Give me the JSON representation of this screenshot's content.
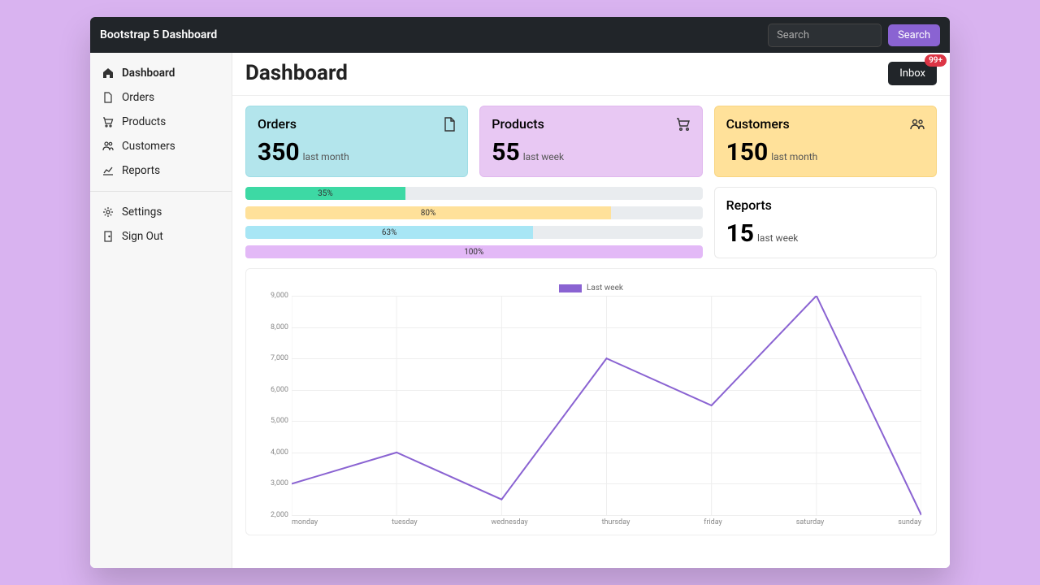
{
  "brand": "Bootstrap 5 Dashboard",
  "search": {
    "placeholder": "Search",
    "button": "Search"
  },
  "sidebar": {
    "items": [
      {
        "label": "Dashboard",
        "icon": "home"
      },
      {
        "label": "Orders",
        "icon": "file"
      },
      {
        "label": "Products",
        "icon": "cart"
      },
      {
        "label": "Customers",
        "icon": "users"
      },
      {
        "label": "Reports",
        "icon": "chart"
      }
    ],
    "items2": [
      {
        "label": "Settings",
        "icon": "gear"
      },
      {
        "label": "Sign Out",
        "icon": "door"
      }
    ]
  },
  "page": {
    "title": "Dashboard",
    "inbox_label": "Inbox",
    "inbox_badge": "99+"
  },
  "cards": {
    "orders": {
      "title": "Orders",
      "value": "350",
      "period": "last month"
    },
    "products": {
      "title": "Products",
      "value": "55",
      "period": "last week"
    },
    "customers": {
      "title": "Customers",
      "value": "150",
      "period": "last month"
    },
    "reports": {
      "title": "Reports",
      "value": "15",
      "period": "last week"
    }
  },
  "progress": [
    {
      "pct": 35,
      "label": "35%",
      "color": "#3dd9a4"
    },
    {
      "pct": 80,
      "label": "80%",
      "color": "#ffe19a"
    },
    {
      "pct": 63,
      "label": "63%",
      "color": "#a8e6f5"
    },
    {
      "pct": 100,
      "label": "100%",
      "color": "#e3b9f7"
    }
  ],
  "chart_data": {
    "type": "line",
    "title": "",
    "legend": "Last week",
    "xlabel": "",
    "ylabel": "",
    "ylim": [
      2000,
      9000
    ],
    "yticks": [
      2000,
      3000,
      4000,
      5000,
      6000,
      7000,
      8000,
      9000
    ],
    "ytick_labels": [
      "2,000",
      "3,000",
      "4,000",
      "5,000",
      "6,000",
      "7,000",
      "8,000",
      "9,000"
    ],
    "categories": [
      "monday",
      "tuesday",
      "wednesday",
      "thursday",
      "friday",
      "saturday",
      "sunday"
    ],
    "series": [
      {
        "name": "Last week",
        "values": [
          3000,
          4000,
          2500,
          7000,
          5500,
          9000,
          2000
        ],
        "color": "#8a63d2"
      }
    ]
  }
}
